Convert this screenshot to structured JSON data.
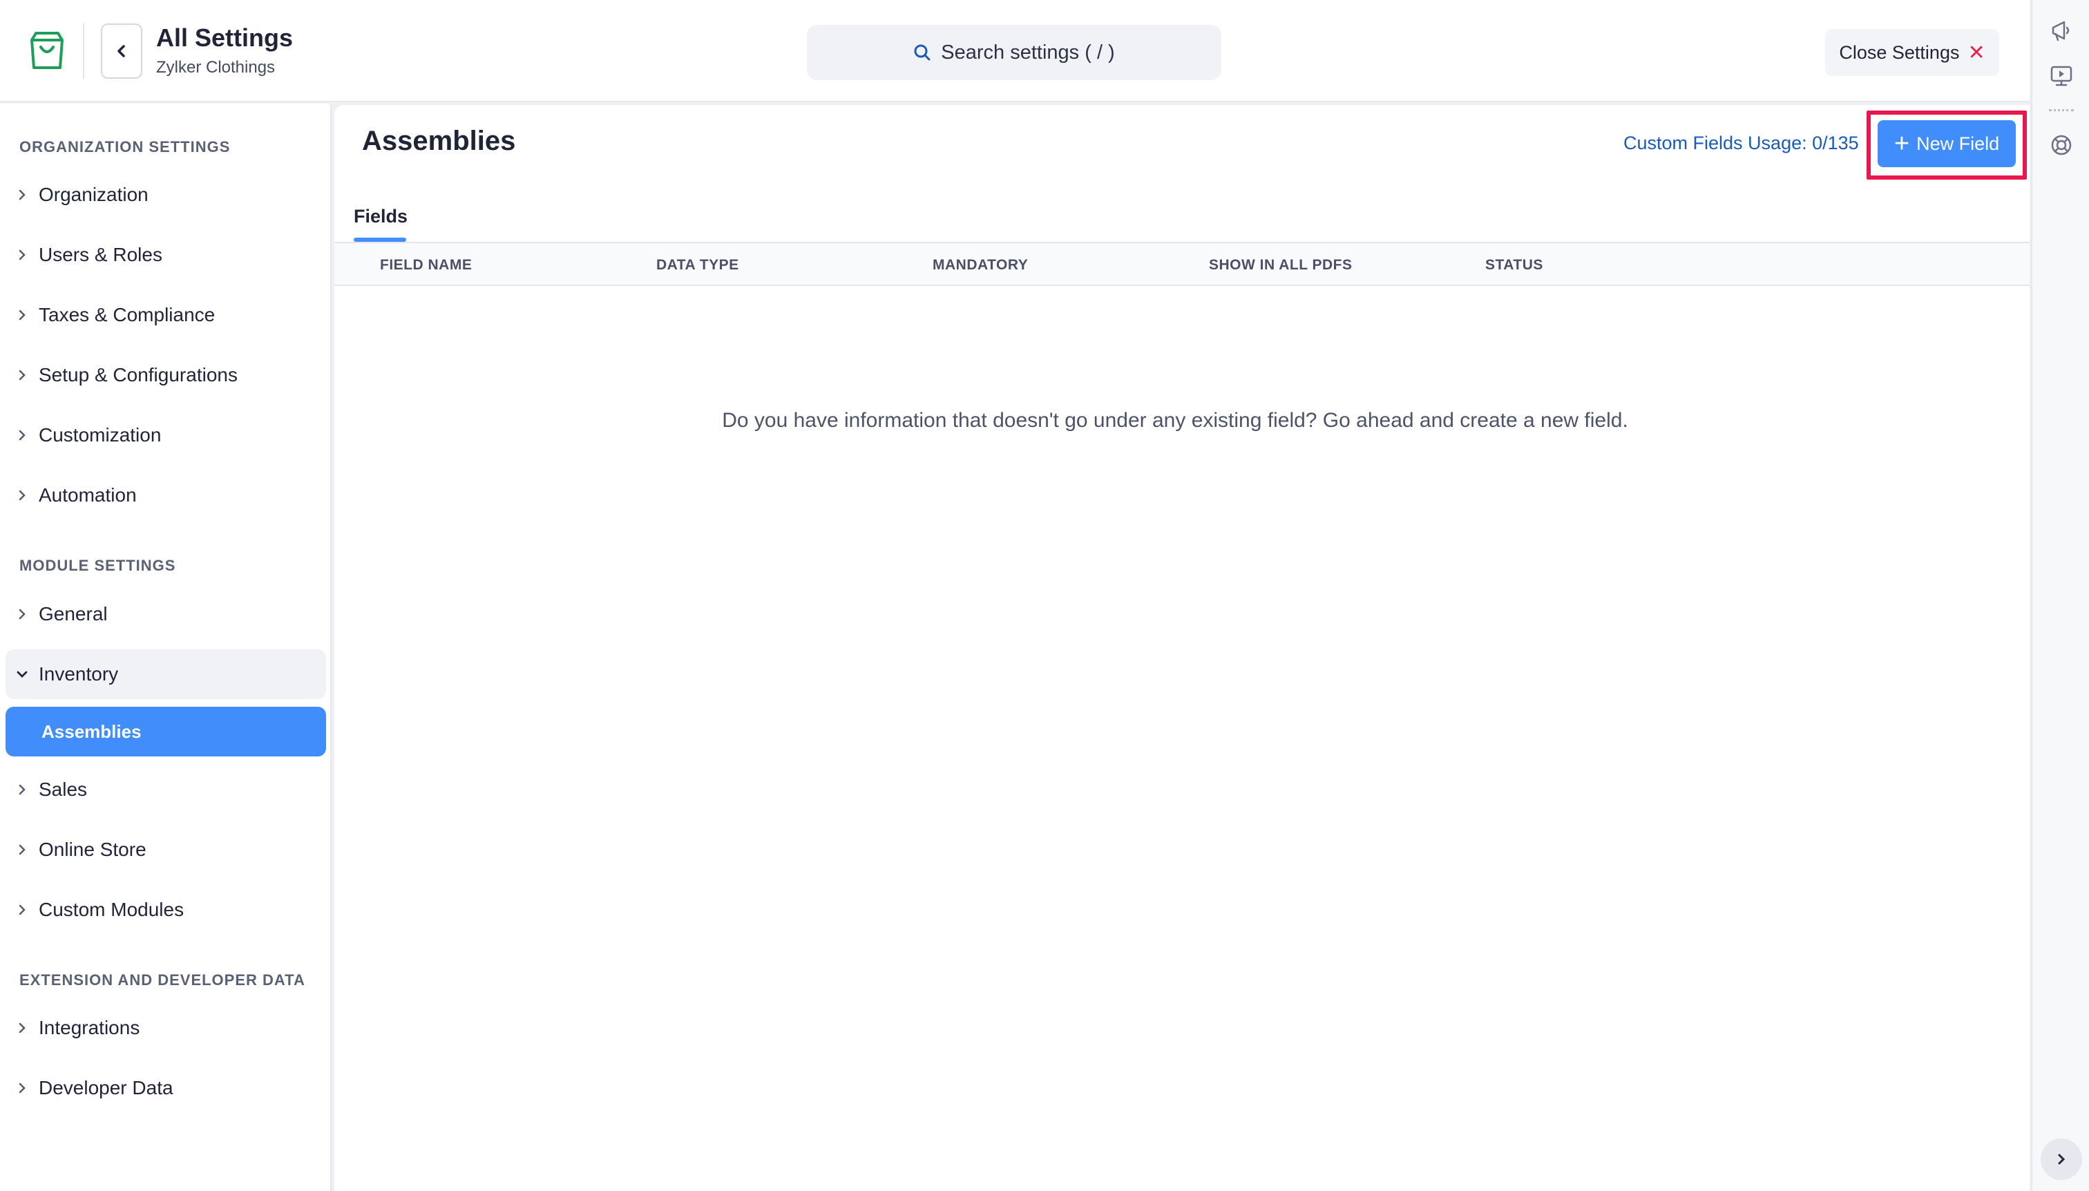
{
  "header": {
    "title": "All Settings",
    "subtitle": "Zylker Clothings",
    "search_placeholder": "Search settings ( / )",
    "close_label": "Close Settings"
  },
  "sidebar": {
    "org_section": "ORGANIZATION SETTINGS",
    "org_items": [
      "Organization",
      "Users & Roles",
      "Taxes & Compliance",
      "Setup & Configurations",
      "Customization",
      "Automation"
    ],
    "module_section": "MODULE SETTINGS",
    "module_items": [
      "General",
      "Inventory"
    ],
    "inventory_sub": "Assemblies",
    "module_items_after": [
      "Sales",
      "Online Store",
      "Custom Modules"
    ],
    "ext_section": "EXTENSION AND DEVELOPER DATA",
    "ext_items": [
      "Integrations",
      "Developer Data"
    ]
  },
  "main": {
    "page_title": "Assemblies",
    "usage": "Custom Fields Usage: 0/135",
    "new_field_label": "New Field",
    "tab": "Fields",
    "columns": [
      "FIELD NAME",
      "DATA TYPE",
      "MANDATORY",
      "SHOW IN ALL PDFS",
      "STATUS"
    ],
    "empty_message": "Do you have information that doesn't go under any existing field? Go ahead and create a new field."
  },
  "colors": {
    "accent": "#408dfb",
    "highlight": "#e8174d",
    "link": "#1a5bb8",
    "brand_green": "#1e9e5a"
  },
  "icons": [
    "shopping-bag-logo-icon",
    "chevron-left-icon",
    "search-icon",
    "close-icon",
    "chevron-right-icon",
    "chevron-down-icon",
    "plus-icon",
    "megaphone-icon",
    "video-tutorial-icon",
    "help-lifebuoy-icon"
  ]
}
